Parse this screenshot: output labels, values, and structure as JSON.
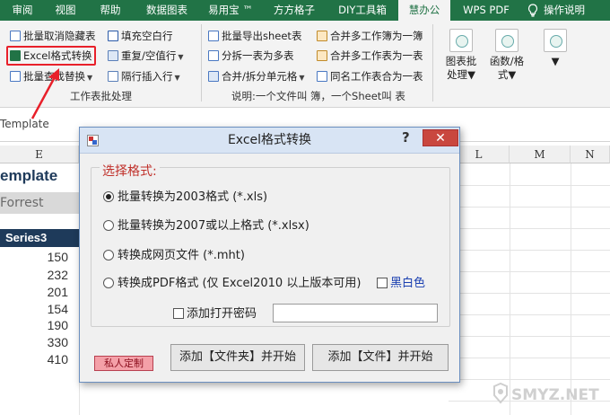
{
  "ribbon_tabs": [
    {
      "label": "审阅",
      "active": false
    },
    {
      "label": "视图",
      "active": false
    },
    {
      "label": "帮助",
      "active": false
    },
    {
      "label": "数据图表",
      "active": false
    },
    {
      "label": "易用宝 ™",
      "active": false
    },
    {
      "label": "方方格子",
      "active": false
    },
    {
      "label": "DIY工具箱",
      "active": false
    },
    {
      "label": "慧办公",
      "active": true
    },
    {
      "label": "WPS PDF",
      "active": false
    },
    {
      "label": "操作说明",
      "active": false
    }
  ],
  "ribbon": {
    "group1": {
      "items": [
        {
          "label": "批量取消隐藏表",
          "icon": "unhide-sheets-icon"
        },
        {
          "label": "Excel格式转换",
          "icon": "excel-convert-icon"
        },
        {
          "label": "批量查找替换",
          "icon": "find-replace-icon",
          "dropdown": true
        },
        {
          "label": "填充空白行",
          "icon": "fill-blank-icon"
        },
        {
          "label": "重复/空值行",
          "icon": "duplicate-rows-icon",
          "dropdown": true
        },
        {
          "label": "隔行插入行",
          "icon": "insert-rows-icon",
          "dropdown": true
        }
      ],
      "label": "工作表批处理"
    },
    "group2": {
      "items": [
        {
          "label": "批量导出sheet表",
          "icon": "export-sheets-icon"
        },
        {
          "label": "分拆一表为多表",
          "icon": "split-sheet-icon"
        },
        {
          "label": "合并/拆分单元格",
          "icon": "merge-cells-icon",
          "dropdown": true
        },
        {
          "label": "合并多工作簿为一簿",
          "icon": "merge-books-icon"
        },
        {
          "label": "合并多工作表为一表",
          "icon": "merge-sheets-icon"
        },
        {
          "label": "同名工作表合为一表",
          "icon": "same-name-merge-icon"
        }
      ],
      "label": "说明:一个文件叫 簿，一个Sheet叫 表"
    },
    "group3": [
      {
        "line1": "图表批",
        "line2": "处理"
      },
      {
        "line1": "函数/格",
        "line2": "式"
      }
    ]
  },
  "formula_bar": {
    "text": "Template"
  },
  "sheet": {
    "columns": [
      "E",
      "L",
      "M",
      "N"
    ],
    "title": "emplate",
    "author": "Forrest",
    "series_header": "Series3",
    "values": [
      "150",
      "232",
      "201",
      "154",
      "190",
      "330",
      "410"
    ]
  },
  "dialog": {
    "title": "Excel格式转换",
    "help": "?",
    "close": "✕",
    "legend": "选择格式:",
    "options": [
      {
        "label": "批量转换为2003格式 (*.xls)",
        "selected": true
      },
      {
        "label": "批量转换为2007或以上格式 (*.xlsx)",
        "selected": false
      },
      {
        "label": "转换成网页文件 (*.mht)",
        "selected": false
      },
      {
        "label": "转换成PDF格式 (仅 Excel2010 以上版本可用)",
        "selected": false
      }
    ],
    "bw_label": "黑白色",
    "password_label": "添加打开密码",
    "password_value": "",
    "custom_button": "私人定制",
    "folder_button": "添加【文件夹】并开始",
    "file_button": "添加【文件】并开始"
  },
  "watermark": "SMYZ.NET",
  "colors": {
    "ribbon_green": "#217346",
    "highlight_red": "#e8202a",
    "header_navy": "#1e3a5a",
    "legend_red": "#c0302a",
    "bw_blue": "#1a3fb0"
  }
}
